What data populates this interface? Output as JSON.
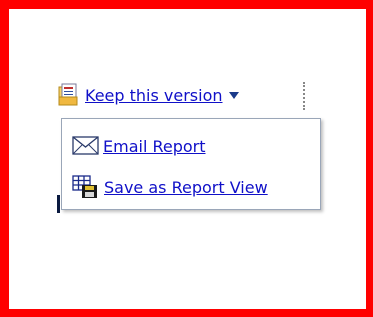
{
  "colors": {
    "background_border": "#ff0000",
    "link": "#1010c8"
  },
  "keep_version": {
    "label": "Keep this version",
    "icon": "report-folder-icon",
    "caret_icon": "caret-down-icon"
  },
  "menu": {
    "items": [
      {
        "label": "Email Report",
        "icon": "envelope-icon"
      },
      {
        "label": "Save as Report View",
        "icon": "report-grid-save-icon"
      }
    ]
  }
}
